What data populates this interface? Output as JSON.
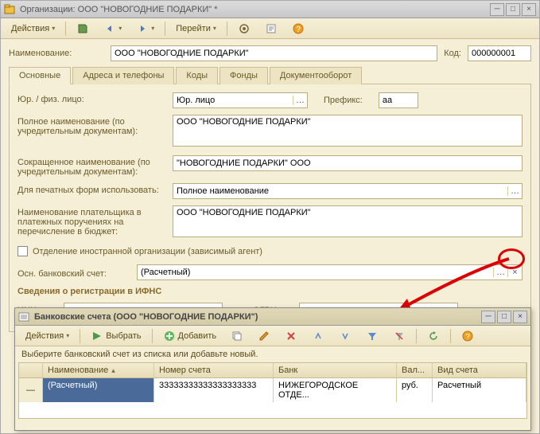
{
  "mainWindow": {
    "title": "Организации: ООО \"НОВОГОДНИЕ ПОДАРКИ\" *",
    "toolbar": {
      "actions": "Действия",
      "goto": "Перейти"
    },
    "nameLabel": "Наименование:",
    "nameValue": "ООО \"НОВОГОДНИЕ ПОДАРКИ\"",
    "codeLabel": "Код:",
    "codeValue": "000000001",
    "tabs": [
      "Основные",
      "Адреса и телефоны",
      "Коды",
      "Фонды",
      "Документооборот"
    ],
    "fields": {
      "yurFizLabel": "Юр. / физ. лицо:",
      "yurFizValue": "Юр. лицо",
      "prefixLabel": "Префикс:",
      "prefixValue": "аа",
      "fullNameLabel": "Полное наименование (по учредительным документам):",
      "fullNameValue": "ООО \"НОВОГОДНИЕ ПОДАРКИ\"",
      "shortNameLabel": "Сокращенное наименование (по учредительным документам):",
      "shortNameValue": "\"НОВОГОДНИЕ ПОДАРКИ\" ООО",
      "printFormLabel": "Для печатных форм использовать:",
      "printFormValue": "Полное наименование",
      "payerNameLabel": "Наименование плательщика в платежных поручениях на перечисление в бюджет:",
      "payerNameValue": "ООО \"НОВОГОДНИЕ ПОДАРКИ\"",
      "foreignBranchLabel": "Отделение иностранной организации (зависимый агент)",
      "bankAccountLabel": "Осн. банковский счет:",
      "bankAccountValue": "(Расчетный)",
      "ifnsSection": "Сведения о регистрации в ИФНС",
      "innLabel": "ИНН:",
      "innValue": "",
      "ogrnLabel": "ОГРН:",
      "ogrnValue": ""
    }
  },
  "childWindow": {
    "title": "Банковские счета (ООО \"НОВОГОДНИЕ ПОДАРКИ\")",
    "toolbar": {
      "actions": "Действия",
      "select": "Выбрать",
      "add": "Добавить"
    },
    "hint": "Выберите банковский счет из списка или добавьте новый.",
    "columns": {
      "name": "Наименование",
      "account": "Номер счета",
      "bank": "Банк",
      "currency": "Вал...",
      "type": "Вид счета"
    },
    "row": {
      "name": "(Расчетный)",
      "account": "33333333333333333333",
      "bank": "НИЖЕГОРОДСКОЕ ОТДЕ...",
      "currency": "руб.",
      "type": "Расчетный"
    }
  }
}
